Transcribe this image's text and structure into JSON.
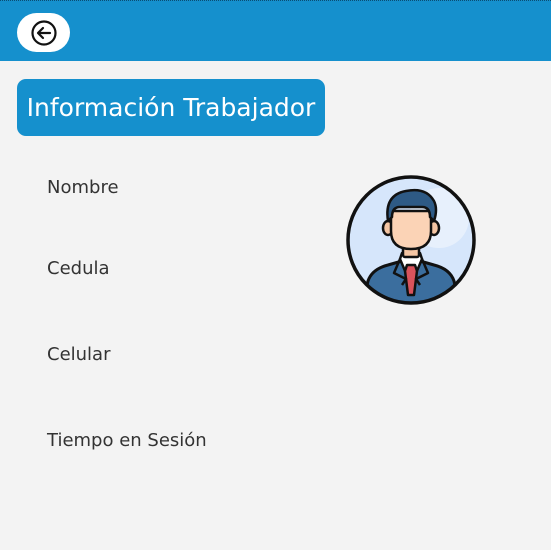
{
  "header": {
    "back_icon": "arrow-left-circle-icon",
    "bar_color": "#1590cd"
  },
  "main": {
    "title": "Información Trabajador",
    "fields": [
      {
        "label": "Nombre"
      },
      {
        "label": "Cedula"
      },
      {
        "label": "Celular"
      },
      {
        "label": "Tiempo en Sesión"
      }
    ],
    "avatar_icon": "businessman-avatar-icon"
  }
}
